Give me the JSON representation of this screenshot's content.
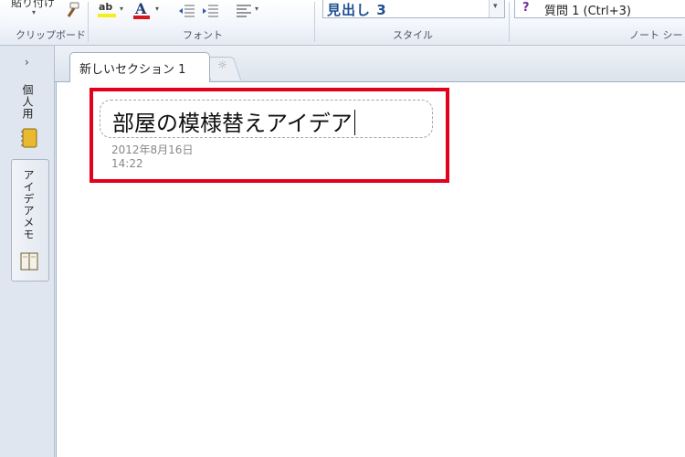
{
  "ribbon": {
    "paste_label": "貼り付け",
    "groups": {
      "clipboard": "クリップボード",
      "font": "フォント",
      "style": "スタイル",
      "tags": "ノート シー"
    },
    "style_value": "見出し 3",
    "tag_icon": "?",
    "tag_value": "質問 1 (Ctrl+3)",
    "font_color_letter": "A",
    "highlight_letters": "ab",
    "colors": {
      "highlight_yellow": "#f6ee1e",
      "font_red": "#d8161c",
      "style_blue": "#1f4e92"
    }
  },
  "sidebar": {
    "collapse": "›",
    "notebooks": [
      {
        "label": "個人用",
        "icon": "notebook-yellow-icon"
      },
      {
        "label": "アイデアメモ",
        "icon": "notebook-open-icon"
      }
    ]
  },
  "tabs": {
    "active_label": "新しいセクション 1",
    "new_tab_icon": "☼"
  },
  "page": {
    "title": "部屋の模様替えアイデア",
    "date": "2012年8月16日",
    "time": "14:22",
    "highlight_color": "#e2001a"
  }
}
